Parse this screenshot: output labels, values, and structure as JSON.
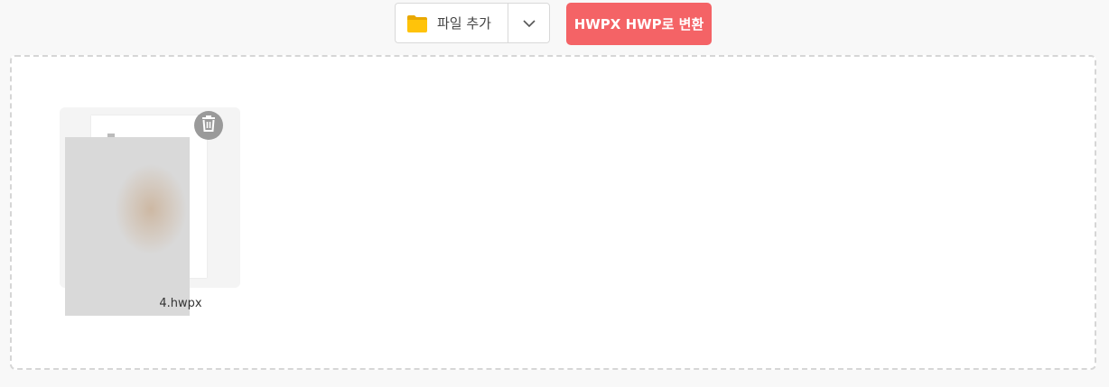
{
  "toolbar": {
    "add_file_label": "파일 추가",
    "folder_icon": "folder-icon",
    "dropdown_icon": "chevron-down-icon",
    "convert_label": "HWPX HWP로 변환",
    "convert_color": "#f46366"
  },
  "dropzone": {
    "files": [
      {
        "name": "4.hwpx",
        "delete_icon": "trash-icon"
      }
    ]
  }
}
